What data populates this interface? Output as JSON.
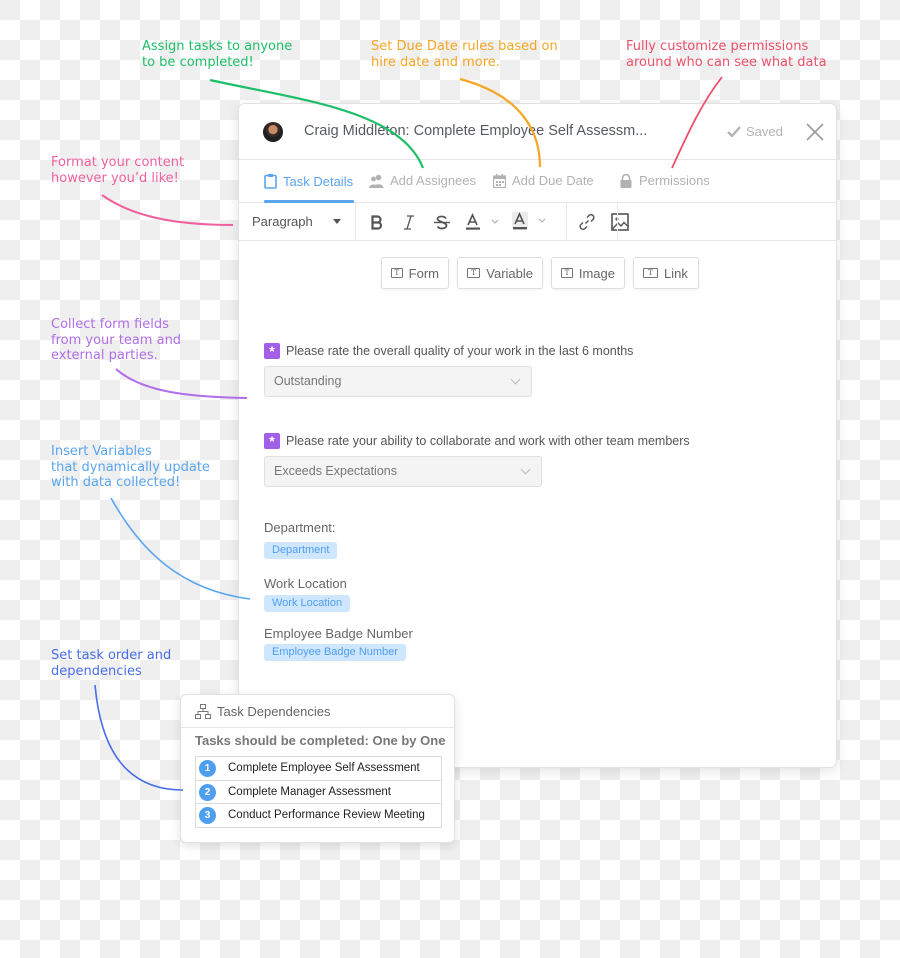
{
  "callouts": {
    "assign": {
      "text": "Assign tasks to anyone\nto be completed!",
      "color": "#1fbf6a"
    },
    "due_date": {
      "text": "Set Due Date rules based on\nhire date and more.",
      "color": "#f5a623"
    },
    "permissions": {
      "text": "Fully customize permissions\naround who can see what data",
      "color": "#ec4f6a"
    },
    "format": {
      "text": "Format your content\nhowever you’d like!",
      "color": "#f0609e"
    },
    "forms": {
      "text": "Collect form fields\nfrom your team and\nexternal parties.",
      "color": "#b06ee8"
    },
    "variables": {
      "text": "Insert Variables\nthat dynamically update\nwith data collected!",
      "color": "#5aa5f0"
    },
    "dependencies": {
      "text": "Set task order and\ndependencies",
      "color": "#4a6ee8"
    }
  },
  "modal": {
    "title": "Craig Middleton: Complete Employee Self Assessm...",
    "saved_label": "Saved",
    "tabs": [
      {
        "label": "Task Details",
        "icon": "clipboard-icon",
        "active": true
      },
      {
        "label": "Add Assignees",
        "icon": "users-icon",
        "active": false
      },
      {
        "label": "Add Due Date",
        "icon": "calendar-icon",
        "active": false
      },
      {
        "label": "Permissions",
        "icon": "lock-icon",
        "active": false
      }
    ],
    "toolbar": {
      "paragraph_label": "Paragraph",
      "buttons": [
        "bold",
        "italic",
        "strikethrough",
        "text-color",
        "highlight-color",
        "link",
        "image"
      ]
    },
    "insert_buttons": [
      {
        "label": "Form"
      },
      {
        "label": "Variable"
      },
      {
        "label": "Image"
      },
      {
        "label": "Link"
      }
    ],
    "questions": [
      {
        "label": "Please rate the overall quality of your work in the last 6 months",
        "value": "Outstanding",
        "required": true
      },
      {
        "label": "Please rate your ability to collaborate and work with other team members",
        "value": "Exceeds Expectations",
        "required": true
      }
    ],
    "variables": [
      {
        "label": "Department:",
        "chip": "Department"
      },
      {
        "label": "Work Location",
        "chip": "Work Location"
      },
      {
        "label": "Employee Badge Number",
        "chip": "Employee Badge Number"
      }
    ]
  },
  "dependencies": {
    "title": "Task Dependencies",
    "subtitle": "Tasks should be completed: One by One",
    "items": [
      {
        "num": "1",
        "label": "Complete Employee Self Assessment"
      },
      {
        "num": "2",
        "label": "Complete Manager Assessment"
      },
      {
        "num": "3",
        "label": "Conduct Performance Review Meeting"
      }
    ]
  },
  "colors": {
    "accent_blue": "#5aa5f0",
    "required_purple": "#a35ee8",
    "chip_bg": "#cfe6ff"
  }
}
